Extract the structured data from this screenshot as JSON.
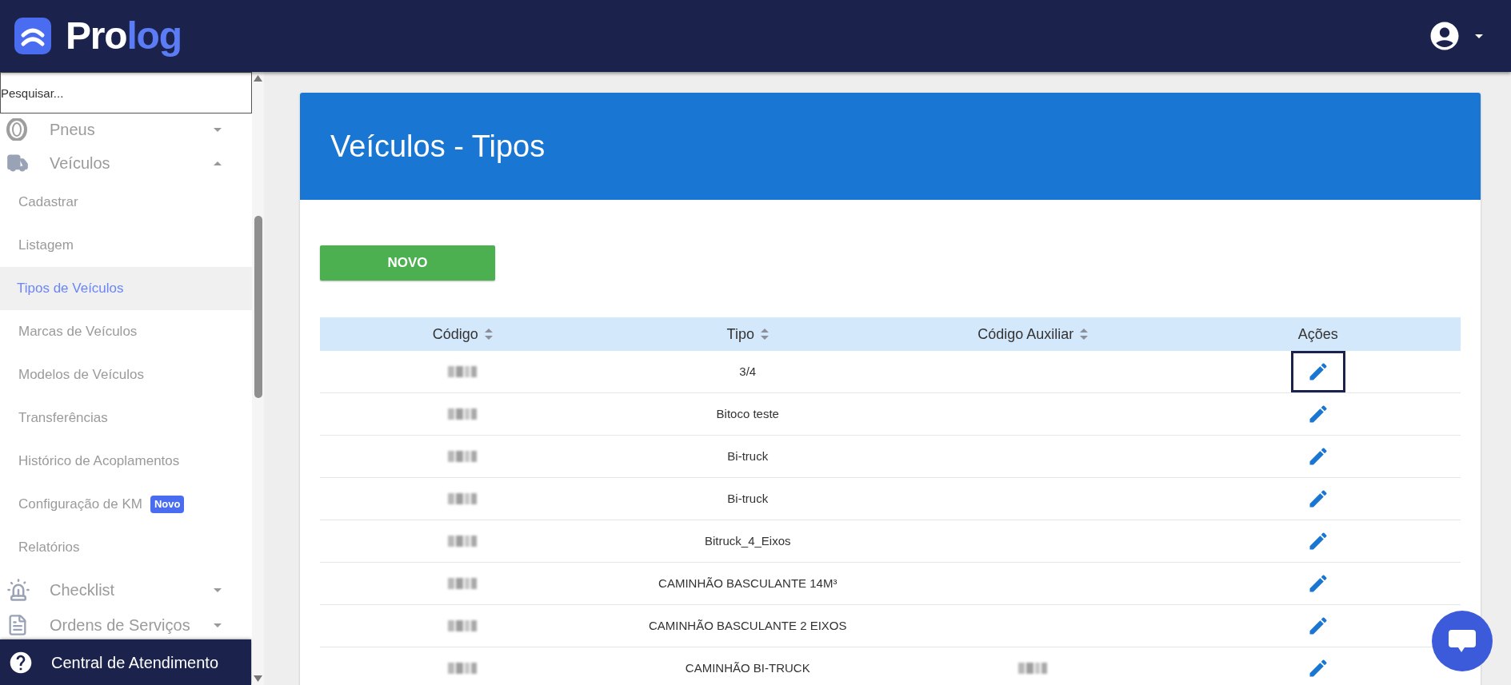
{
  "header": {
    "logo": {
      "first": "Pro",
      "second": "log"
    }
  },
  "sidebar": {
    "search": {
      "placeholder": "Pesquisar..."
    },
    "items": [
      {
        "label": "Pneus",
        "kind": "tire",
        "expanded": false
      },
      {
        "label": "Veículos",
        "kind": "truck",
        "expanded": true,
        "children": [
          {
            "label": "Cadastrar",
            "selected": false
          },
          {
            "label": "Listagem",
            "selected": false
          },
          {
            "label": "Tipos de Veículos",
            "selected": true
          },
          {
            "label": "Marcas de Veículos",
            "selected": false
          },
          {
            "label": "Modelos de Veículos",
            "selected": false
          },
          {
            "label": "Transferências",
            "selected": false
          },
          {
            "label": "Histórico de Acoplamentos",
            "selected": false
          },
          {
            "label": "Configuração de KM",
            "selected": false,
            "badge": "Novo"
          },
          {
            "label": "Relatórios",
            "selected": false
          }
        ]
      },
      {
        "label": "Checklist",
        "kind": "siren",
        "expanded": false
      },
      {
        "label": "Ordens de Serviços",
        "kind": "document",
        "expanded": false
      }
    ],
    "help_bar": {
      "label": "Central de Atendimento"
    }
  },
  "page": {
    "title": "Veículos - Tipos",
    "new_button": "NOVO",
    "table": {
      "columns": [
        {
          "label": "Código",
          "sortable": true
        },
        {
          "label": "Tipo",
          "sortable": true
        },
        {
          "label": "Código Auxiliar",
          "sortable": true
        },
        {
          "label": "Ações",
          "sortable": false
        }
      ],
      "rows": [
        {
          "code_blurred": true,
          "tipo": "3/4",
          "aux_blurred": false,
          "focused": true
        },
        {
          "code_blurred": true,
          "tipo": "Bitoco teste",
          "aux_blurred": false,
          "focused": false
        },
        {
          "code_blurred": true,
          "tipo": "Bi-truck",
          "aux_blurred": false,
          "focused": false
        },
        {
          "code_blurred": true,
          "tipo": "Bi-truck",
          "aux_blurred": false,
          "focused": false
        },
        {
          "code_blurred": true,
          "tipo": "Bitruck_4_Eixos",
          "aux_blurred": false,
          "focused": false
        },
        {
          "code_blurred": true,
          "tipo": "CAMINHÃO BASCULANTE 14M³",
          "aux_blurred": false,
          "focused": false
        },
        {
          "code_blurred": true,
          "tipo": "CAMINHÃO BASCULANTE 2 EIXOS",
          "aux_blurred": false,
          "focused": false
        },
        {
          "code_blurred": true,
          "tipo": "CAMINHÃO BI-TRUCK",
          "aux_blurred": true,
          "focused": false
        }
      ]
    }
  }
}
